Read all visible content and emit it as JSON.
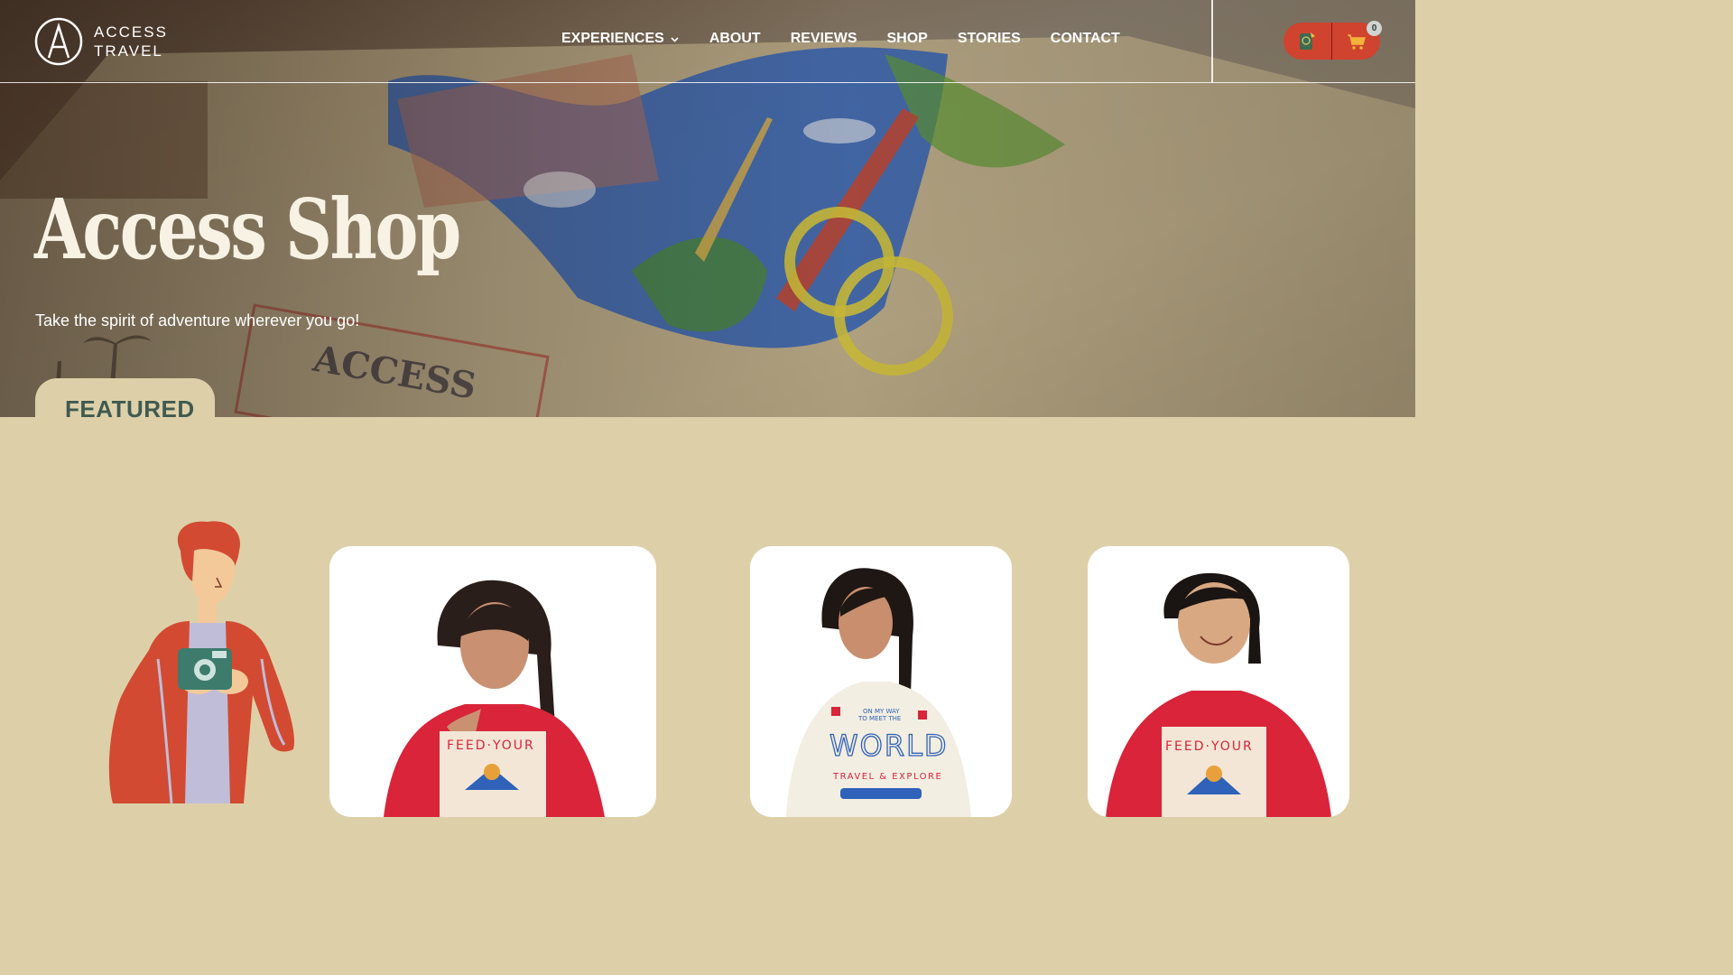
{
  "brand": {
    "line1": "ACCESS",
    "line2": "TRAVEL"
  },
  "nav": {
    "items": [
      {
        "label": "EXPERIENCES",
        "has_dropdown": true
      },
      {
        "label": "ABOUT"
      },
      {
        "label": "REVIEWS"
      },
      {
        "label": "SHOP"
      },
      {
        "label": "STORIES"
      },
      {
        "label": "CONTACT"
      }
    ]
  },
  "actions": {
    "passport_icon": "passport-icon",
    "cart_icon": "cart-icon",
    "cart_count": "0"
  },
  "hero": {
    "title": "Access Shop",
    "subtitle": "Take the spirit of adventure wherever you go!"
  },
  "featured": {
    "label": "FEATURED"
  },
  "colors": {
    "accent_red": "#d0432f",
    "sand": "#ddd0a9",
    "forest": "#3f5a50",
    "sweater_red": "#d9243a",
    "sweater_cream": "#f3eee2"
  }
}
